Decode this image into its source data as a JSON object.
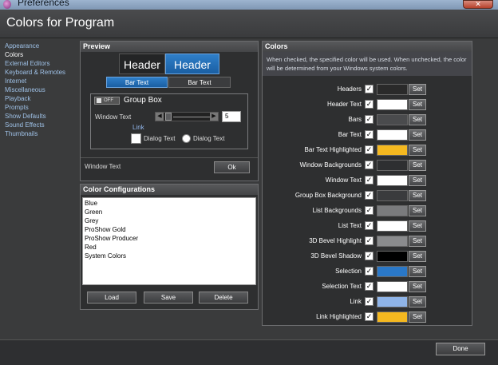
{
  "window": {
    "title": "Preferences",
    "close_glyph": "✕",
    "icon": "app-icon"
  },
  "header": {
    "title": "Colors for Program"
  },
  "sidebar": {
    "items": [
      {
        "label": "Appearance",
        "active": false
      },
      {
        "label": "Colors",
        "active": true
      },
      {
        "label": "External Editors",
        "active": false
      },
      {
        "label": "Keyboard & Remotes",
        "active": false
      },
      {
        "label": "Internet",
        "active": false
      },
      {
        "label": "Miscellaneous",
        "active": false
      },
      {
        "label": "Playback",
        "active": false
      },
      {
        "label": "Prompts",
        "active": false
      },
      {
        "label": "Show Defaults",
        "active": false
      },
      {
        "label": "Sound Effects",
        "active": false
      },
      {
        "label": "Thumbnails",
        "active": false
      }
    ]
  },
  "preview": {
    "title": "Preview",
    "header1": "Header",
    "header2": "Header",
    "bar1": "Bar Text",
    "bar2": "Bar Text",
    "groupbox": {
      "toggle": "OFF",
      "title": "Group Box",
      "window_text": "Window Text",
      "slider_left": "◀",
      "slider_right": "▶",
      "number": "5",
      "link": "Link",
      "checkbox_label": "Dialog Text",
      "radio_label": "Dialog Text"
    },
    "window_text": "Window Text",
    "ok": "Ok"
  },
  "color_config": {
    "title": "Color Configurations",
    "items": [
      "Blue",
      "Green",
      "Grey",
      "ProShow Gold",
      "ProShow Producer",
      "Red",
      "System Colors"
    ],
    "load": "Load",
    "save": "Save",
    "delete": "Delete"
  },
  "colors": {
    "title": "Colors",
    "description": "When checked, the specified color will be used. When unchecked, the color will be determined from your Windows system colors.",
    "set_label": "Set",
    "check_glyph": "✓",
    "rows": [
      {
        "label": "Headers",
        "color": "#2a2a2a"
      },
      {
        "label": "Header Text",
        "color": "#ffffff"
      },
      {
        "label": "Bars",
        "color": "#4a4b4d"
      },
      {
        "label": "Bar Text",
        "color": "#ffffff"
      },
      {
        "label": "Bar Text Highlighted",
        "color": "#f4b820"
      },
      {
        "label": "Window Backgrounds",
        "color": "#2e2f31"
      },
      {
        "label": "Window Text",
        "color": "#ffffff"
      },
      {
        "label": "Group Box Background",
        "color": "#3a3b3d"
      },
      {
        "label": "List Backgrounds",
        "color": "#7a7b7d"
      },
      {
        "label": "List Text",
        "color": "#ffffff"
      },
      {
        "label": "3D Bevel Highlight",
        "color": "#8a8b8d"
      },
      {
        "label": "3D Bevel Shadow",
        "color": "#000000"
      },
      {
        "label": "Selection",
        "color": "#2a78c8"
      },
      {
        "label": "Selection Text",
        "color": "#ffffff"
      },
      {
        "label": "Link",
        "color": "#8fb4e8"
      },
      {
        "label": "Link Highlighted",
        "color": "#f4b820"
      }
    ]
  },
  "bottom": {
    "done": "Done"
  }
}
